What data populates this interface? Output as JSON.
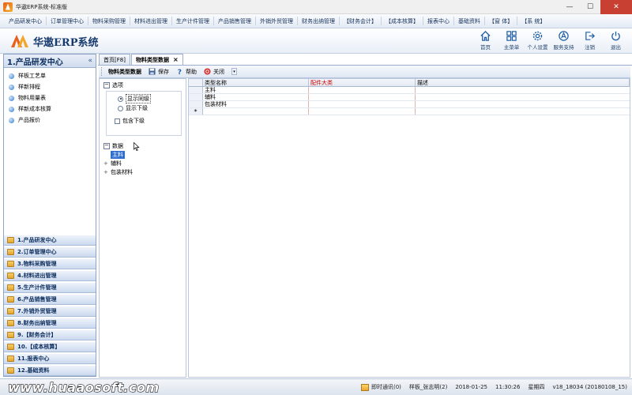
{
  "window": {
    "title": "华遨ERP系统-标准版"
  },
  "menu": [
    "产品研发中心",
    "订单管理中心",
    "物料采购管理",
    "材料进出管理",
    "生产计件管理",
    "产品销售管理",
    "外销外贸管理",
    "财务出纳管理",
    "【财务会计】",
    "【成本核算】",
    "报表中心",
    "基础资料",
    "【窗 体】",
    "【系 统】"
  ],
  "header": {
    "brand": "华遨ERP系统",
    "buttons": [
      {
        "label": "首页",
        "icon": "home-icon"
      },
      {
        "label": "主菜单",
        "icon": "grid-menu-icon"
      },
      {
        "label": "个人设置",
        "icon": "gear-icon"
      },
      {
        "label": "服务支持",
        "icon": "support-icon"
      },
      {
        "label": "注销",
        "icon": "logout-icon"
      },
      {
        "label": "退出",
        "icon": "power-icon"
      }
    ]
  },
  "sidebar": {
    "title": "1.产品研发中心",
    "collapse": "«",
    "submodules": [
      "样板工艺单",
      "样新排程",
      "物料用量表",
      "样新成本核算",
      "产品报价"
    ],
    "modules": [
      "1.产品研发中心",
      "2.订单管理中心",
      "3.物料采购管理",
      "4.材料进出管理",
      "5.生产计件管理",
      "6.产品销售管理",
      "7.外销外贸管理",
      "8.财务出纳管理",
      "9.【财务会计】",
      "10.【成本核算】",
      "11.报表中心",
      "12.基础资料"
    ]
  },
  "tabs": [
    {
      "label": "首页[F8]",
      "active": false
    },
    {
      "label": "物料类型数据",
      "active": true,
      "close": "×"
    }
  ],
  "toolbar": {
    "title": "物料类型数据",
    "save": "保存",
    "help": "帮助",
    "close": "关闭",
    "dropdown": "▾"
  },
  "filter": {
    "options_title": "选项",
    "opt_same": "显示同级",
    "opt_lower": "显示下级",
    "include_lower": "包含下级",
    "data_title": "数据",
    "tree": [
      {
        "label": "主料",
        "selected": true,
        "expander": ""
      },
      {
        "label": "辅料",
        "selected": false,
        "expander": "+"
      },
      {
        "label": "包装材料",
        "selected": false,
        "expander": "+"
      }
    ]
  },
  "grid": {
    "columns": [
      "类型名称",
      "配件大类",
      "描述"
    ],
    "rows": [
      [
        "主料",
        "",
        ""
      ],
      [
        "辅料",
        "",
        ""
      ],
      [
        "包装材料",
        "",
        ""
      ]
    ],
    "new_row_marker": "*"
  },
  "status": {
    "website": "www.huaaosoft.com",
    "message": "即时通讯(0)",
    "user": "样板_张志明(2)",
    "date": "2018-01-25",
    "time": "11:30:26",
    "weekday": "星期四",
    "version": "v18_18034 (20180108_15)"
  },
  "colors": {
    "accent": "#173a6e",
    "highlight": "#2f6fd0",
    "logo_orange": "#e8611c",
    "logo_yellow": "#f2a629"
  }
}
